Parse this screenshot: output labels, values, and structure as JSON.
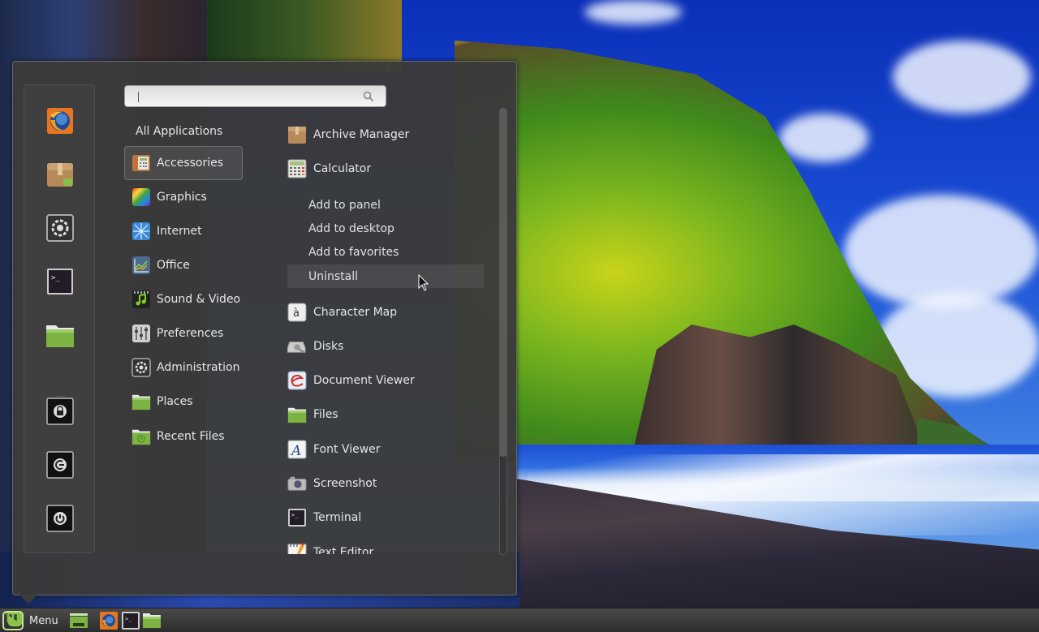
{
  "search": {
    "placeholder": "",
    "value": ""
  },
  "favorites": [
    {
      "name": "firefox",
      "label": "Firefox"
    },
    {
      "name": "archive-manager",
      "label": "Archive Manager"
    },
    {
      "name": "system-settings",
      "label": "System Settings"
    },
    {
      "name": "terminal",
      "label": "Terminal"
    },
    {
      "name": "files",
      "label": "Files"
    }
  ],
  "session_buttons": [
    {
      "name": "lock-screen",
      "icon": "lock-icon"
    },
    {
      "name": "logout",
      "icon": "logout-icon"
    },
    {
      "name": "shutdown",
      "icon": "power-icon"
    }
  ],
  "categories": {
    "all": "All Applications",
    "items": [
      {
        "label": "Accessories",
        "icon": "accessories-icon",
        "selected": true
      },
      {
        "label": "Graphics",
        "icon": "graphics-icon"
      },
      {
        "label": "Internet",
        "icon": "internet-icon"
      },
      {
        "label": "Office",
        "icon": "office-icon"
      },
      {
        "label": "Sound & Video",
        "icon": "sound-video-icon"
      },
      {
        "label": "Preferences",
        "icon": "preferences-icon"
      },
      {
        "label": "Administration",
        "icon": "administration-icon"
      },
      {
        "label": "Places",
        "icon": "places-folder-icon"
      },
      {
        "label": "Recent Files",
        "icon": "recent-files-icon"
      }
    ]
  },
  "apps": {
    "archive_manager": "Archive Manager",
    "calculator": "Calculator",
    "character_map": "Character Map",
    "disks": "Disks",
    "document_viewer": "Document Viewer",
    "files": "Files",
    "font_viewer": "Font Viewer",
    "screenshot": "Screenshot",
    "terminal": "Terminal",
    "text_editor": "Text Editor"
  },
  "context_menu": {
    "add_to_panel": "Add to panel",
    "add_to_desktop": "Add to desktop",
    "add_to_favorites": "Add to favorites",
    "uninstall": "Uninstall"
  },
  "scrollbar": {
    "visible_fraction": 0.78,
    "position": 0.0
  },
  "taskbar": {
    "menu_label": "Menu",
    "launchers": [
      "Show Desktop",
      "Firefox",
      "Terminal",
      "Files"
    ]
  },
  "colors": {
    "menu_bg": "#3a3a3a",
    "text": "#e6e6e6",
    "mint_green": "#8bc34a",
    "folder_green": "#7cb342"
  }
}
